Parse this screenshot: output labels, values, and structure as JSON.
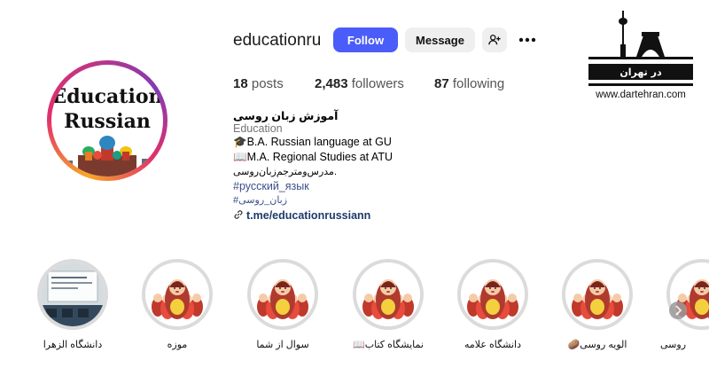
{
  "profile": {
    "username": "educationru",
    "follow_label": "Follow",
    "message_label": "Message",
    "avatar_text_line1": "Education",
    "avatar_text_line2": "Russian"
  },
  "stats": {
    "posts_count": "18",
    "posts_label": "posts",
    "followers_count": "2,483",
    "followers_label": "followers",
    "following_count": "87",
    "following_label": "following"
  },
  "bio": {
    "name": "آموزش زبان روسی",
    "category": "Education",
    "line1": "🎓B.A. Russian language at GU",
    "line2": "📖M.A. Regional Studies at ATU",
    "line3": "مدرس‌ومترجم‌زبان‌روسی.",
    "hashtag1": "#русский_язык",
    "hashtag2": "#زبان_روسی",
    "link": "t.me/educationrussiann"
  },
  "watermark": {
    "persian": "در تهران",
    "url": "www.dartehran.com"
  },
  "highlights": [
    {
      "label": "دانشگاه الزهرا"
    },
    {
      "label": "موزه"
    },
    {
      "label": "سوال از شما"
    },
    {
      "label": "نمایشگاه کتاب📖"
    },
    {
      "label": "دانشگاه علامه"
    },
    {
      "label": "الویه روسی🥔"
    },
    {
      "label": "روسی"
    }
  ],
  "colors": {
    "accent": "#4a5df9",
    "hashtag": "#3d4f8a",
    "secondary_text": "#737373"
  },
  "icons": [
    "add-user-icon",
    "more-icon",
    "link-icon",
    "next-chevron-icon"
  ]
}
